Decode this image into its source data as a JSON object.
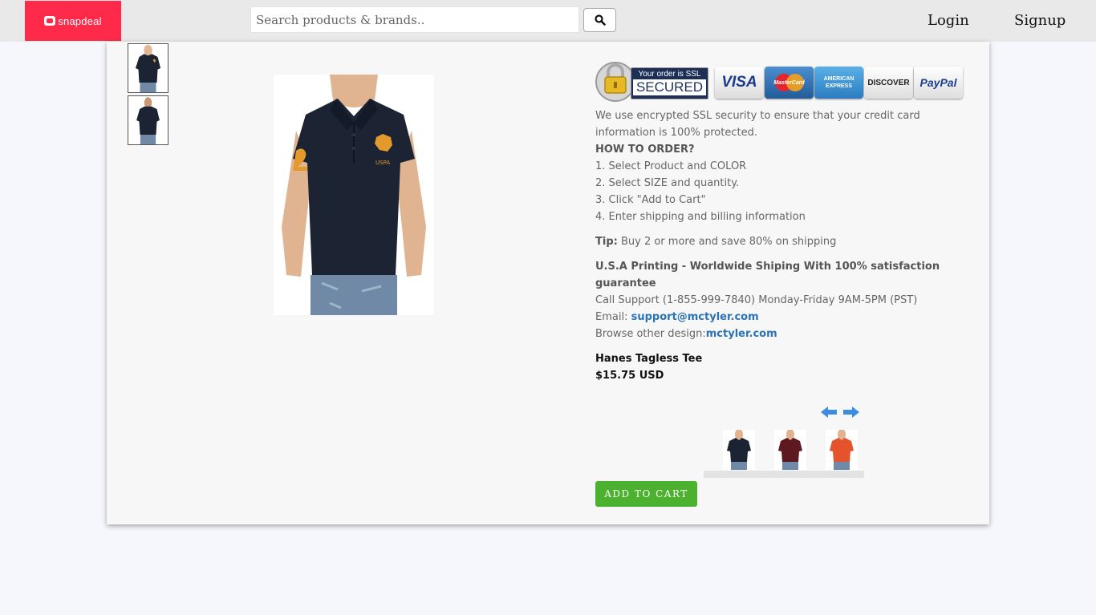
{
  "header": {
    "logo_text": "snapdeal",
    "search_placeholder": "Search products & brands..",
    "login_label": "Login",
    "signup_label": "Signup"
  },
  "security": {
    "badge_line1": "Your order is SSL",
    "badge_line2": "SECURED",
    "payment_cards": [
      "VISA",
      "MasterCard",
      "AMERICAN EXPRESS",
      "DISCOVER",
      "PayPal"
    ]
  },
  "info": {
    "ssl_text": "We use encrypted SSL security to ensure that your credit card information is 100% protected.",
    "how_to_order_title": "HOW TO ORDER?",
    "steps": [
      "1. Select Product and COLOR",
      "2. Select SIZE and quantity.",
      "3. Click \"Add to Cart\"",
      "4. Enter shipping and billing information"
    ],
    "tip_label": "Tip:",
    "tip_text": "Buy 2 or more and save 80% on shipping",
    "guarantee": "U.S.A Printing - Worldwide Shiping With 100% satisfaction guarantee",
    "support": "Call Support (1-855-999-7840) Monday-Friday 9AM-5PM (PST)",
    "email_label": "Email:",
    "email": "support@mctyler.com",
    "browse_label": "Browse other design:",
    "browse_link": "mctyler.com"
  },
  "product": {
    "name": "Hanes Tagless Tee",
    "price": "$15.75 USD",
    "add_to_cart_label": "ADD TO CART"
  },
  "colors": {
    "navy": "#1c2433",
    "maroon": "#5e1820",
    "orange": "#e4532c",
    "accent_green": "#4cb12f",
    "link_blue": "#2a73b8",
    "brand_red": "#ff2a4a"
  }
}
